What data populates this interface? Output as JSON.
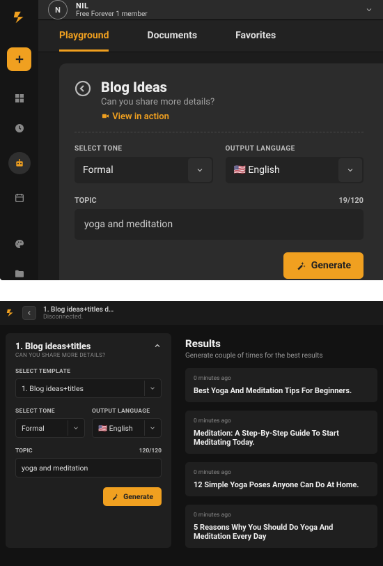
{
  "user": {
    "avatar_letter": "N",
    "name": "NIL",
    "plan": "Free Forever 1 member"
  },
  "tabs": {
    "playground": "Playground",
    "documents": "Documents",
    "favorites": "Favorites"
  },
  "panel": {
    "title": "Blog Ideas",
    "subtitle": "Can you share more details?",
    "view_action": "View in action",
    "tone_label": "SELECT TONE",
    "lang_label": "OUTPUT LANGUAGE",
    "tone_value": "Formal",
    "lang_value": "🇺🇸 English",
    "topic_label": "TOPIC",
    "topic_counter": "19/120",
    "topic_value": "yoga and meditation",
    "generate": "Generate"
  },
  "shot2": {
    "crumb": "1. Blog ideas+titles d…",
    "status": "Disconnected.",
    "left": {
      "title": "1. Blog ideas+titles",
      "subtitle": "CAN YOU SHARE MORE DETAILS?",
      "template_label": "SELECT TEMPLATE",
      "template_value": "1. Blog ideas+titles",
      "tone_label": "SELECT TONE",
      "lang_label": "OUTPUT LANGUAGE",
      "tone_value": "Formal",
      "lang_value": "🇺🇸 English",
      "topic_label": "TOPIC",
      "topic_counter": "120/120",
      "topic_value": "yoga and meditation",
      "generate": "Generate"
    },
    "results": {
      "title": "Results",
      "subtitle": "Generate couple of times for the best results",
      "items": [
        {
          "ts": "0 minutes ago",
          "text": "Best Yoga And Meditation Tips For Beginners."
        },
        {
          "ts": "0 minutes ago",
          "text": "Meditation: A Step-By-Step Guide To Start Meditating Today."
        },
        {
          "ts": "0 minutes ago",
          "text": "12 Simple Yoga Poses Anyone Can Do At Home."
        },
        {
          "ts": "0 minutes ago",
          "text": "5 Reasons Why You Should Do Yoga And Meditation Every Day"
        }
      ]
    }
  }
}
